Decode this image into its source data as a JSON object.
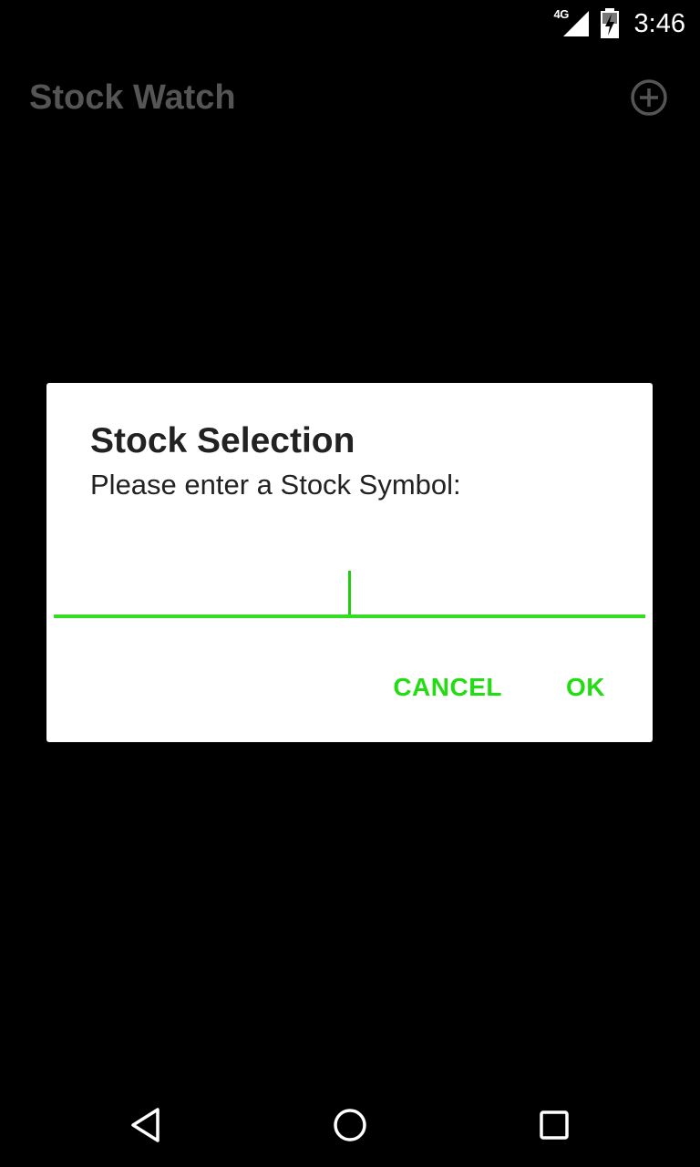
{
  "status_bar": {
    "network": "4G",
    "time": "3:46"
  },
  "app": {
    "title": "Stock Watch",
    "add_icon": "add-circle-icon"
  },
  "dialog": {
    "title": "Stock Selection",
    "message": "Please enter a Stock Symbol:",
    "input_value": "",
    "cancel_label": "CANCEL",
    "ok_label": "OK",
    "accent_color": "#22dd11"
  },
  "nav_bar": {
    "back_icon": "back-icon",
    "home_icon": "home-icon",
    "recents_icon": "recents-icon"
  }
}
